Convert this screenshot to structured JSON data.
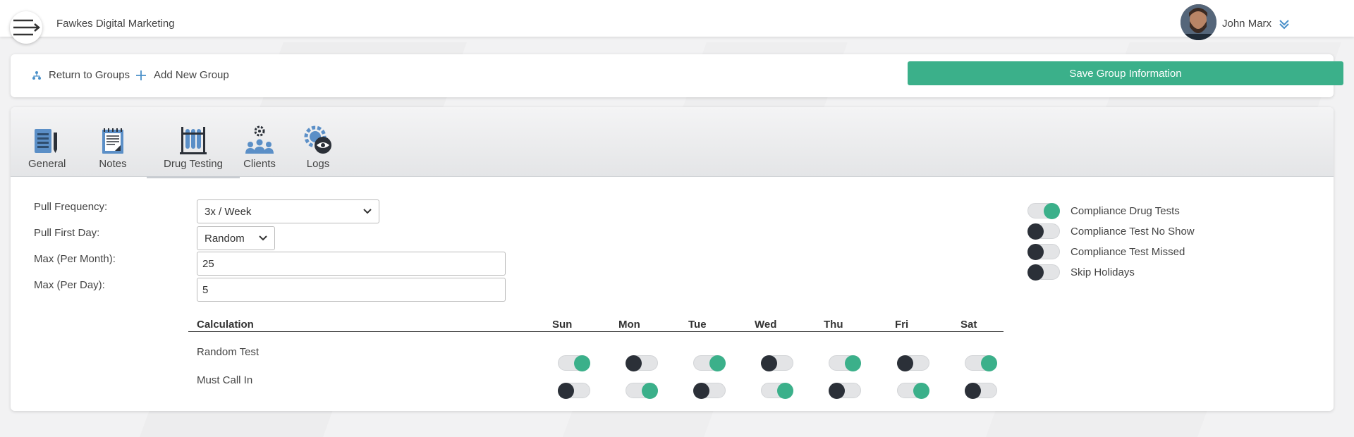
{
  "header": {
    "company": "Fawkes Digital Marketing",
    "user_name": "John Marx"
  },
  "actions": {
    "return_label": "Return to Groups",
    "add_label": "Add New Group",
    "save_label": "Save Group Information"
  },
  "tabs": [
    {
      "label": "General",
      "icon": "notebook-pen-icon"
    },
    {
      "label": "Notes",
      "icon": "notes-icon"
    },
    {
      "label": "Drug Testing",
      "icon": "test-tubes-icon",
      "active": true
    },
    {
      "label": "Clients",
      "icon": "users-gear-icon"
    },
    {
      "label": "Logs",
      "icon": "gear-eye-icon"
    }
  ],
  "form": {
    "pull_frequency": {
      "label": "Pull Frequency:",
      "value": "3x / Week"
    },
    "pull_first_day": {
      "label": "Pull First Day:",
      "value": "Random"
    },
    "max_month": {
      "label": "Max (Per Month):",
      "value": "25"
    },
    "max_day": {
      "label": "Max (Per Day):",
      "value": "5"
    }
  },
  "compliance": [
    {
      "label": "Compliance Drug Tests",
      "on": true
    },
    {
      "label": "Compliance Test No Show",
      "on": false
    },
    {
      "label": "Compliance Test Missed",
      "on": false
    },
    {
      "label": "Skip Holidays",
      "on": false
    }
  ],
  "calculation": {
    "header": "Calculation",
    "days": [
      "Sun",
      "Mon",
      "Tue",
      "Wed",
      "Thu",
      "Fri",
      "Sat"
    ],
    "rows": [
      {
        "label": "Random Test",
        "values": [
          true,
          false,
          true,
          false,
          true,
          false,
          true
        ]
      },
      {
        "label": "Must Call In",
        "values": [
          false,
          true,
          false,
          true,
          false,
          true,
          false
        ]
      }
    ]
  },
  "colors": {
    "accent": "#3bb08a",
    "toggle_off_knob": "#2b3038",
    "icon_blue": "#5b8fc7"
  }
}
